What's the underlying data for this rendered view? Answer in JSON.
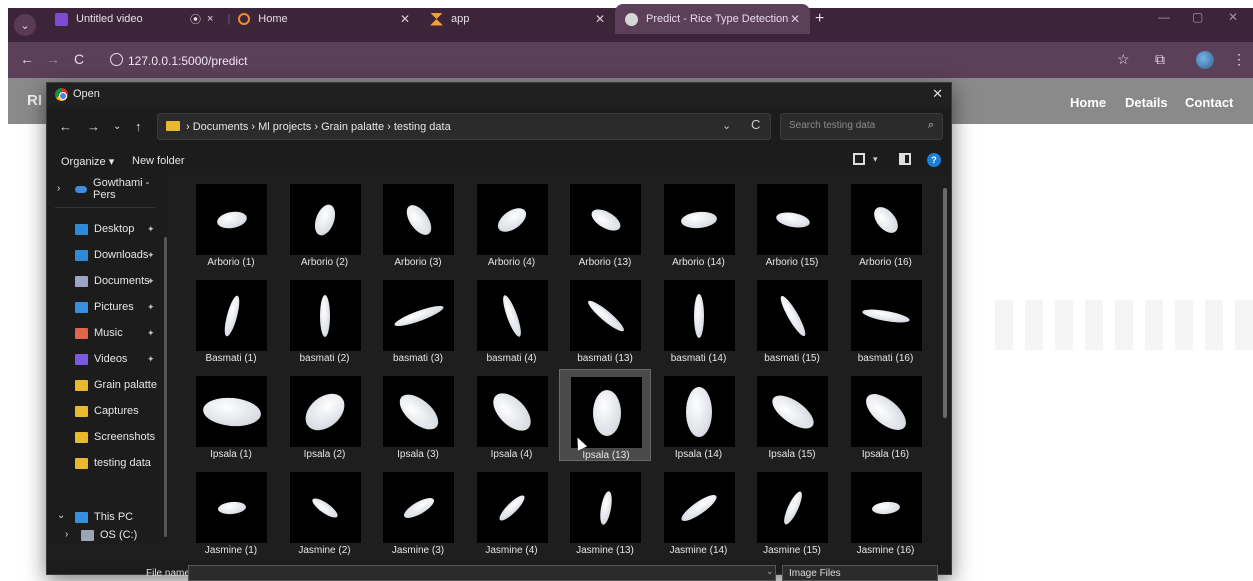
{
  "browser": {
    "tabs": [
      {
        "label": "Untitled video",
        "favicon_color": "#7b4bd1"
      },
      {
        "label": "Home",
        "favicon_color": "#f28c28",
        "recording": "⦿"
      },
      {
        "label": "app",
        "favicon_color": "#f2a03a"
      },
      {
        "label": "Predict - Rice Type Detection",
        "favicon_color": "#cccccc"
      }
    ],
    "url": "127.0.0.1:5000/predict"
  },
  "site": {
    "brand": "RI",
    "nav": [
      "Home",
      "Details",
      "Contact"
    ]
  },
  "dialog": {
    "title": "Open",
    "path": "›  Documents  ›  Ml projects  ›  Grain palatte  ›  testing data",
    "search_placeholder": "Search testing data",
    "organize": "Organize ▾",
    "new_folder": "New folder",
    "sidebar": {
      "top": "Gowthami - Pers",
      "quick": [
        {
          "label": "Desktop",
          "color": "#2f8bd8",
          "pin": true
        },
        {
          "label": "Downloads",
          "color": "#2f8bd8",
          "pin": true
        },
        {
          "label": "Documents",
          "color": "#9aa6c7",
          "pin": true
        },
        {
          "label": "Pictures",
          "color": "#3a8ee0",
          "pin": true
        },
        {
          "label": "Music",
          "color": "#e0664a",
          "pin": true
        },
        {
          "label": "Videos",
          "color": "#7a5ae0",
          "pin": true
        },
        {
          "label": "Grain palatte",
          "color": "#e8b92f",
          "pin": false
        },
        {
          "label": "Captures",
          "color": "#e8b92f",
          "pin": false
        },
        {
          "label": "Screenshots",
          "color": "#e8b92f",
          "pin": false
        },
        {
          "label": "testing data",
          "color": "#e8b92f",
          "pin": false
        }
      ],
      "this_pc": "This PC",
      "os_drive": "OS (C:)"
    },
    "files": [
      "Arborio (1)",
      "Arborio (2)",
      "Arborio (3)",
      "Arborio (4)",
      "Arborio (13)",
      "Arborio (14)",
      "Arborio (15)",
      "Arborio (16)",
      "Basmati (1)",
      "basmati (2)",
      "basmati (3)",
      "basmati (4)",
      "basmati (13)",
      "basmati (14)",
      "basmati (15)",
      "basmati (16)",
      "Ipsala (1)",
      "Ipsala (2)",
      "Ipsala (3)",
      "Ipsala (4)",
      "Ipsala (13)",
      "Ipsala (14)",
      "Ipsala (15)",
      "Ipsala (16)",
      "Jasmine (1)",
      "Jasmine (2)",
      "Jasmine (3)",
      "Jasmine (4)",
      "Jasmine (13)",
      "Jasmine (14)",
      "Jasmine (15)",
      "Jasmine (16)"
    ],
    "selected_file": "Ipsala (13)",
    "file_name_label": "File name:",
    "file_name_value": "",
    "file_type": "Image Files"
  }
}
